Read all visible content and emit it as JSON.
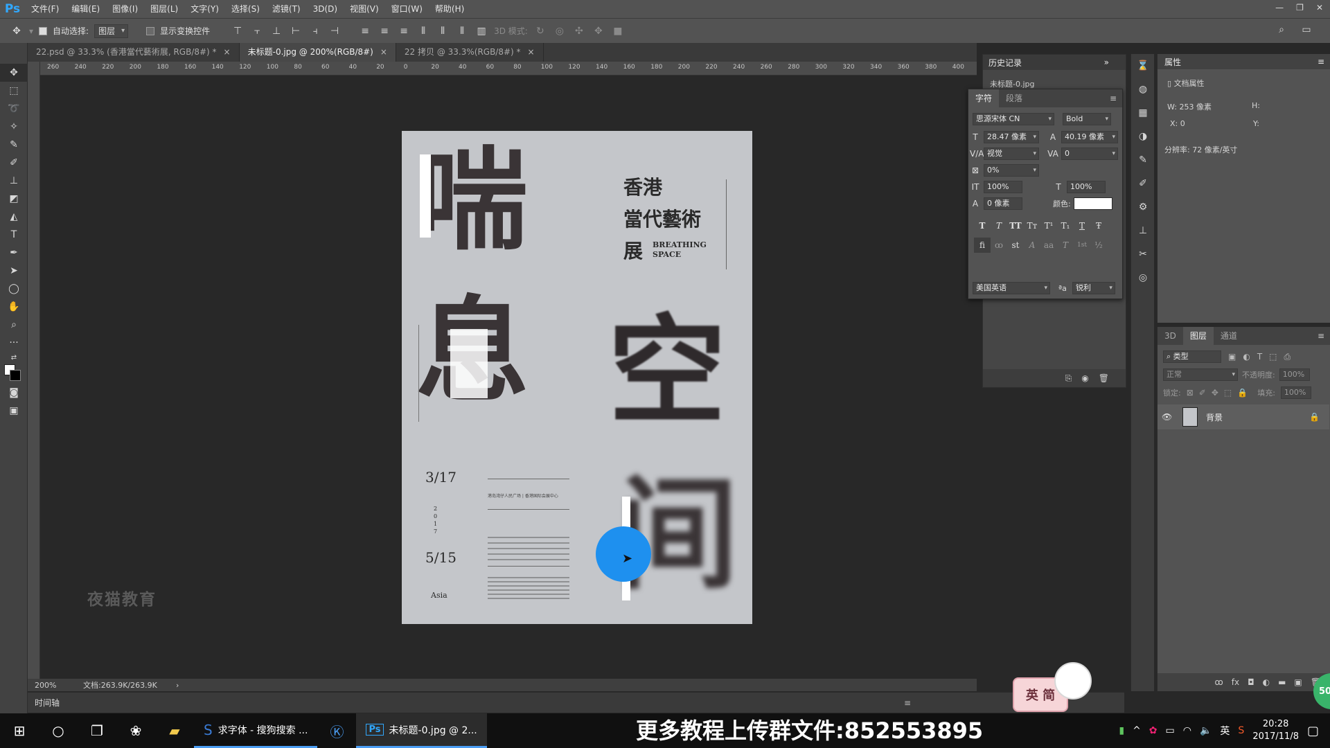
{
  "app": {
    "logo": "Ps",
    "menus": [
      "文件(F)",
      "编辑(E)",
      "图像(I)",
      "图层(L)",
      "文字(Y)",
      "选择(S)",
      "滤镜(T)",
      "3D(D)",
      "视图(V)",
      "窗口(W)",
      "帮助(H)"
    ]
  },
  "options": {
    "auto_select_label": "自动选择:",
    "auto_select_value": "图层",
    "show_transform_label": "显示变换控件",
    "mode_3d_label": "3D 模式:"
  },
  "tabs": [
    {
      "label": "22.psd @ 33.3% (香港當代藝術展, RGB/8#) *",
      "close": "×"
    },
    {
      "label": "未标题-0.jpg @ 200%(RGB/8#)",
      "close": "×"
    },
    {
      "label": "22 拷贝 @ 33.3%(RGB/8#) *",
      "close": "×"
    }
  ],
  "ruler_ticks": [
    "260",
    "240",
    "220",
    "200",
    "180",
    "160",
    "140",
    "120",
    "100",
    "80",
    "60",
    "40",
    "20",
    "0",
    "20",
    "40",
    "60",
    "80",
    "100",
    "120",
    "140",
    "160",
    "180",
    "200",
    "220",
    "240",
    "260",
    "280",
    "300",
    "320",
    "340",
    "360",
    "380",
    "400"
  ],
  "canvas": {
    "watermark": "夜猫教育",
    "poster": {
      "char1": "喘",
      "char2": "息",
      "char3": "空",
      "char4": "间",
      "title_line1": "香港",
      "title_line2": "當代藝術",
      "title_line3": "展",
      "en_line1": "BREATHING",
      "en_line2": "SPACE",
      "date1": "3/17",
      "year": "2017",
      "date2": "5/15",
      "brand": "Asia",
      "info_line": "港岛湾仔人民广场 | 香港国际会展中心"
    }
  },
  "status": {
    "zoom": "200%",
    "doc": "文档:263.9K/263.9K",
    "arrow": "›"
  },
  "timeline_label": "时间轴",
  "history": {
    "title": "历史记录",
    "item": "未标题-0.jpg"
  },
  "character": {
    "tab_char": "字符",
    "tab_para": "段落",
    "font_family": "思源宋体 CN",
    "font_style": "Bold",
    "font_size": "28.47 像素",
    "leading": "40.19 像素",
    "kerning": "视觉",
    "tracking": "0",
    "tsume": "0%",
    "vscale": "100%",
    "hscale": "100%",
    "baseline": "0 像素",
    "color_label": "颜色:",
    "style_buttons": [
      "T",
      "T",
      "TT",
      "Tт",
      "T¹",
      "T₁",
      "T",
      "Ŧ"
    ],
    "ot_buttons": [
      "fi",
      "ꝏ",
      "st",
      "A",
      "aa",
      "T",
      "1st",
      "½"
    ],
    "language": "美国英语",
    "aa_label": "ªa",
    "antialias": "锐利"
  },
  "properties": {
    "title": "属性",
    "doc_props": "文档属性",
    "w_label": "W:",
    "w_value": "253 像素",
    "h_label": "H:",
    "x_label": "X:",
    "x_value": "0",
    "y_label": "Y:",
    "resolution": "分辨率: 72 像素/英寸"
  },
  "layers": {
    "tab_3d": "3D",
    "tab_layers": "图层",
    "tab_channels": "通道",
    "filter_label": "类型",
    "blend_mode": "正常",
    "opacity_label": "不透明度:",
    "opacity": "100%",
    "lock_label": "锁定:",
    "fill_label": "填充:",
    "fill": "100%",
    "layer_name": "背景",
    "footer_icons": [
      "ꝏ",
      "fx",
      "◘",
      "◐",
      "▬",
      "▣",
      "🗑"
    ]
  },
  "mascot_text": "英 简",
  "badge": "50",
  "taskbar": {
    "app1": "求字体 - 搜狗搜索 ...",
    "app2": "未标题-0.jpg @ 2...",
    "banner": "更多教程上传群文件:852553895",
    "ime": "英",
    "time": "20:28",
    "date": "2017/11/8"
  }
}
